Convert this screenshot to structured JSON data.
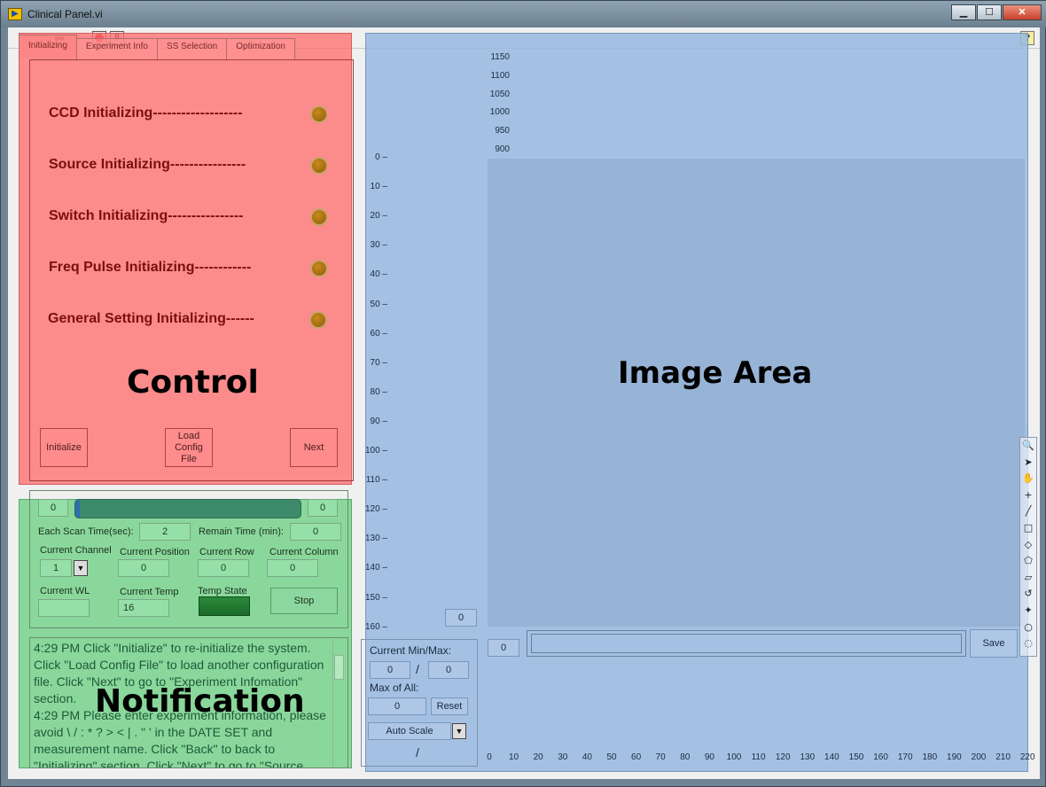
{
  "window": {
    "title": "Clinical Panel.vi",
    "minimize": "▁",
    "maximize": "☐",
    "close": "✕"
  },
  "toolbar": {
    "help": "?"
  },
  "control": {
    "tabs": [
      "Initializing",
      "Experiment Info",
      "SS Selection",
      "Optimization"
    ],
    "rows": [
      "CCD Initializing-------------------",
      "Source Initializing----------------",
      "Switch Initializing----------------",
      "Freq Pulse Initializing------------",
      "General Setting Initializing------"
    ],
    "overlay_label": "Control",
    "buttons": {
      "initialize": "Initialize",
      "load_config": "Load Config File",
      "next": "Next"
    }
  },
  "status": {
    "progress_left": "0",
    "progress_right": "0",
    "progress_fraction": 0.02,
    "each_scan_label": "Each Scan Time(sec):",
    "each_scan_value": "2",
    "remain_label": "Remain Time (min):",
    "remain_value": "0",
    "current_channel_label": "Current Channel",
    "current_channel_value": "1",
    "current_position_label": "Current Position",
    "current_position_value": "0",
    "current_row_label": "Current Row",
    "current_row_value": "0",
    "current_column_label": "Current Column",
    "current_column_value": "0",
    "current_wl_label": "Current WL",
    "current_wl_value": "",
    "current_temp_label": "Current Temp",
    "current_temp_value": "16",
    "temp_state_label": "Temp State",
    "stop_label": "Stop"
  },
  "notification": {
    "overlay_label": "Notification",
    "log": [
      "4:29 PM    Click \"Initialize\" to re-initialize the system. Click \"Load Config File\" to load another configuration file. Click \"Next\" to go to \"Experiment Infomation\" section.",
      "4:29 PM    Please enter experiment information, please avoid \\ / : * ? > < | . \" ' in the DATE SET and measurement name. Click \"Back\" to back to \"Initializing\" section. Click \"Next\" to go to \"Source"
    ]
  },
  "image_area": {
    "overlay_label": "Image Area",
    "colorbar_ticks": [
      "1150",
      "1100",
      "1050",
      "1000",
      "950",
      "900"
    ],
    "y_ticks": [
      "0",
      "10",
      "20",
      "30",
      "40",
      "50",
      "60",
      "70",
      "80",
      "90",
      "100",
      "110",
      "120",
      "130",
      "140",
      "150",
      "160"
    ],
    "x_ticks": [
      "0",
      "10",
      "20",
      "30",
      "40",
      "50",
      "60",
      "70",
      "80",
      "90",
      "100",
      "110",
      "120",
      "130",
      "140",
      "150",
      "160",
      "170",
      "180",
      "190",
      "200",
      "210",
      "220"
    ],
    "cursor_y_value": "0",
    "cursor_x_value": "0",
    "current_minmax_label": "Current Min/Max:",
    "min_value": "0",
    "max_value": "0",
    "slash": "/",
    "max_of_all_label": "Max of All:",
    "max_of_all_value": "0",
    "reset_label": "Reset",
    "autoscale_label": "Auto Scale",
    "save_label": "Save",
    "palette_icons": [
      "magnifier-icon",
      "pointer-icon",
      "hand-icon",
      "crosshair-icon",
      "line-icon",
      "rectangle-icon",
      "rotated-rect-icon",
      "annulus-icon",
      "polygon-icon",
      "freehand-icon",
      "free-polygon-icon",
      "oval-icon",
      "spiral-icon"
    ],
    "palette_glyphs": [
      "🔍",
      "➤",
      "✋",
      "+",
      "╱",
      "□",
      "◇",
      "⬠",
      "▱",
      "↺",
      "✦",
      "○",
      "◌"
    ]
  }
}
